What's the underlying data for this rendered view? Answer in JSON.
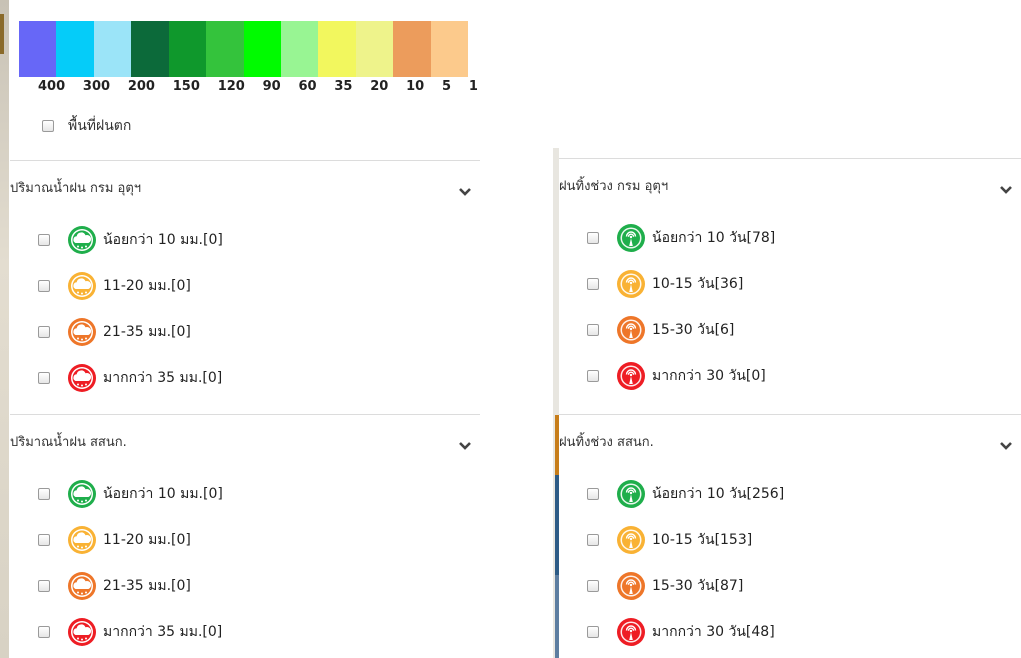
{
  "colors": {
    "green": "#1fae4b",
    "yellow": "#f9b234",
    "orange": "#ee7629",
    "red": "#ee1d24"
  },
  "legend": {
    "swatches": [
      "#6767f7",
      "#05ccf9",
      "#9be4f8",
      "#0c6a3a",
      "#0f982c",
      "#34c33c",
      "#00fb00",
      "#98f593",
      "#f2f75e",
      "#eef38b",
      "#ec9c5c",
      "#fcca8c"
    ],
    "labels": [
      "400",
      "300",
      "200",
      "150",
      "120",
      "90",
      "60",
      "35",
      "20",
      "10",
      "5",
      "1"
    ],
    "rain_area_label": "พื้นที่ฝนตก"
  },
  "left_sections": [
    {
      "title": "ปริมาณน้ำฝน กรม อุตุฯ",
      "icon_type": "rain-cloud-icon",
      "items": [
        {
          "label": "น้อยกว่า 10 มม.[0]",
          "color": "green"
        },
        {
          "label": "11-20 มม.[0]",
          "color": "yellow"
        },
        {
          "label": "21-35 มม.[0]",
          "color": "orange"
        },
        {
          "label": "มากกว่า 35 มม.[0]",
          "color": "red"
        }
      ]
    },
    {
      "title": "ปริมาณน้ำฝน สสนก.",
      "icon_type": "rain-cloud-icon",
      "items": [
        {
          "label": "น้อยกว่า 10 มม.[0]",
          "color": "green"
        },
        {
          "label": "11-20 มม.[0]",
          "color": "yellow"
        },
        {
          "label": "21-35 มม.[0]",
          "color": "orange"
        },
        {
          "label": "มากกว่า 35 มม.[0]",
          "color": "red"
        }
      ]
    }
  ],
  "right_sections": [
    {
      "title": "ฝนทิ้งช่วง กรม อุตุฯ",
      "icon_type": "station-icon",
      "items": [
        {
          "label": "น้อยกว่า 10 วัน[78]",
          "color": "green"
        },
        {
          "label": "10-15 วัน[36]",
          "color": "yellow"
        },
        {
          "label": "15-30 วัน[6]",
          "color": "orange"
        },
        {
          "label": "มากกว่า 30 วัน[0]",
          "color": "red"
        }
      ]
    },
    {
      "title": "ฝนทิ้งช่วง สสนก.",
      "icon_type": "station-icon",
      "items": [
        {
          "label": "น้อยกว่า 10 วัน[256]",
          "color": "green"
        },
        {
          "label": "10-15 วัน[153]",
          "color": "yellow"
        },
        {
          "label": "15-30 วัน[87]",
          "color": "orange"
        },
        {
          "label": "มากกว่า 30 วัน[48]",
          "color": "red"
        }
      ]
    }
  ]
}
